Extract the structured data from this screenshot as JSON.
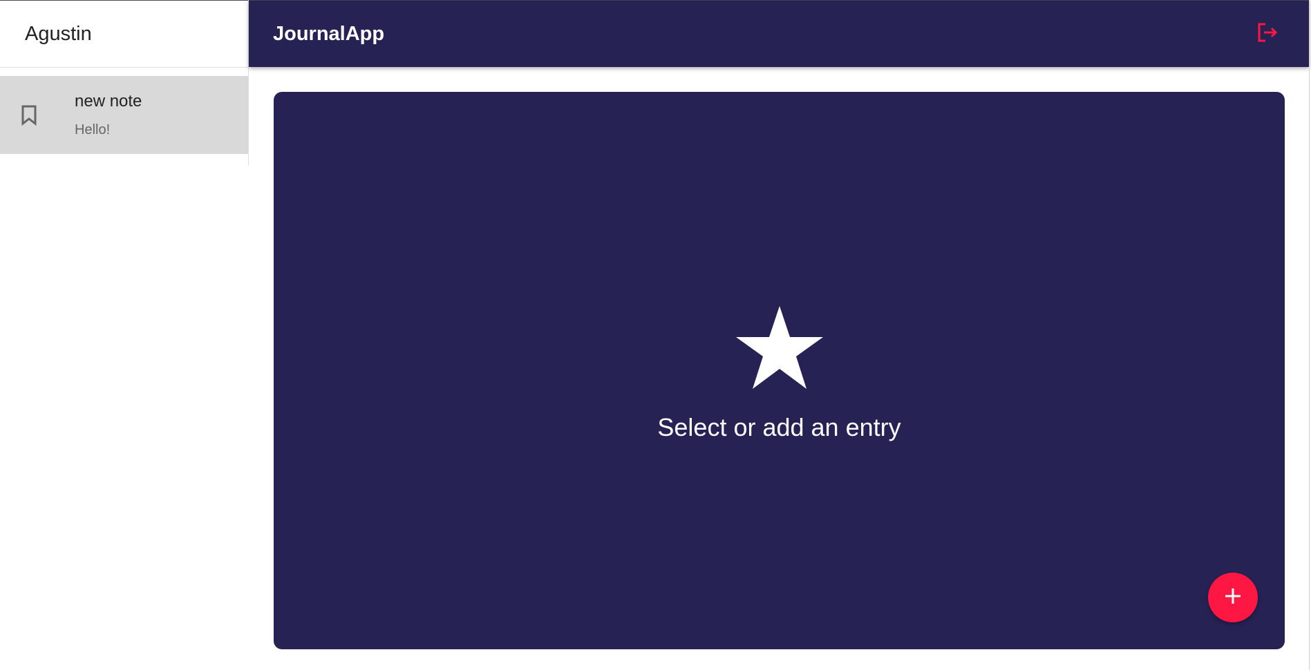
{
  "sidebar": {
    "username": "Agustin",
    "entries": [
      {
        "title": "new note",
        "body": "Hello!",
        "icon": "bookmark-icon"
      }
    ]
  },
  "appbar": {
    "title": "JournalApp",
    "logout_icon": "logout-icon"
  },
  "main": {
    "empty_message": "Select or add an entry",
    "empty_icon": "star-icon",
    "add_icon": "plus-icon"
  },
  "colors": {
    "primary": "#262254",
    "accent": "#ff1744",
    "selected_item": "#d9d9d9"
  }
}
